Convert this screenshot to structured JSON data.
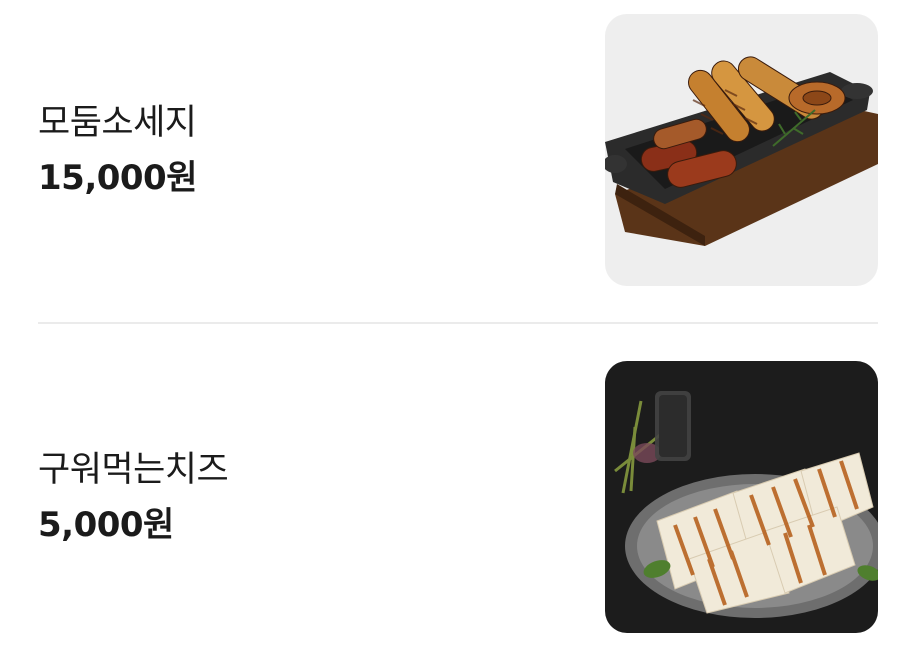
{
  "menu": {
    "items": [
      {
        "name": "모둠소세지",
        "price": "15,000원",
        "image": "sausage-platter-image"
      },
      {
        "name": "구워먹는치즈",
        "price": "5,000원",
        "image": "grilled-cheese-image"
      }
    ]
  },
  "colors": {
    "text": "#1b1b1b",
    "divider": "#ebebeb",
    "thumb_bg_light": "#eeeeee",
    "thumb_bg_dark": "#1c1c1c"
  }
}
